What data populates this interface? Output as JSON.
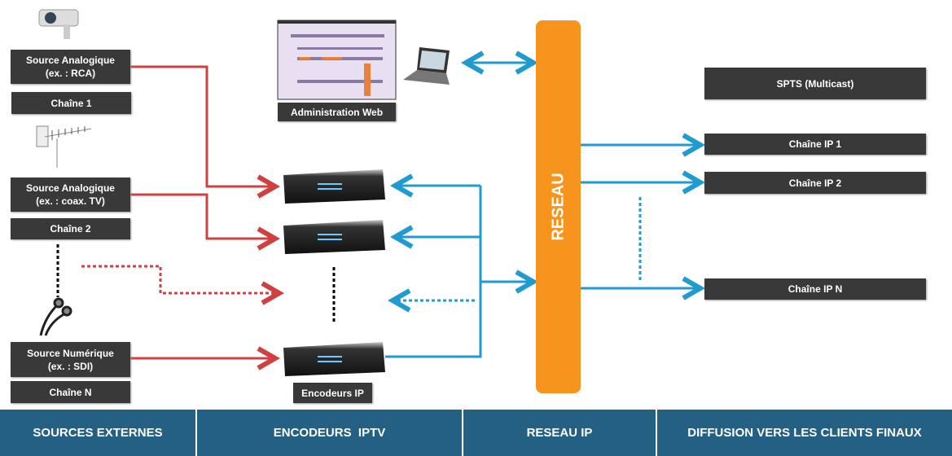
{
  "sources": [
    {
      "source_label": "Source Analogique",
      "source_example": "(ex. : RCA)",
      "channel": "Chaîne 1",
      "icon": "cctv-camera-icon"
    },
    {
      "source_label": "Source Analogique",
      "source_example": "(ex. : coax. TV)",
      "channel": "Chaîne 2",
      "icon": "tv-antenna-icon"
    },
    {
      "source_label": "Source Numérique",
      "source_example": "(ex. : SDI)",
      "channel": "Chaîne N",
      "icon": "bnc-cable-icon"
    }
  ],
  "admin": {
    "label": "Administration Web"
  },
  "encoders": {
    "label": "Encodeurs IP"
  },
  "network": {
    "label": "RESEAU"
  },
  "outputs": {
    "spts": "SPTS (Multicast)",
    "channels": [
      "Chaîne IP 1",
      "Chaîne IP 2",
      "Chaîne IP N"
    ]
  },
  "footer": [
    "SOURCES EXTERNES",
    "ENCODEURS  IPTV",
    "RESEAU IP",
    "DIFFUSION VERS LES CLIENTS FINAUX"
  ],
  "colors": {
    "red": "#d04040",
    "blue": "#1f9bcf",
    "orange": "#f7941d",
    "footer": "#236083",
    "box": "#393939"
  }
}
